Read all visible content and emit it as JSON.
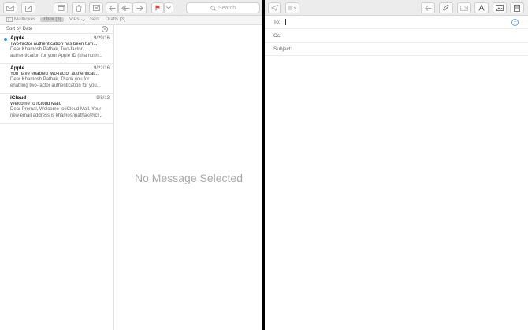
{
  "mail": {
    "search": {
      "placeholder": "Search"
    },
    "favorites": {
      "mailboxes": "Mailboxes",
      "inbox": "Inbox (3)",
      "vips": "VIPs",
      "sent": "Sent",
      "drafts": "Drafts (3)"
    },
    "sort_label": "Sort by Date",
    "messages": [
      {
        "sender": "Apple",
        "date": "9/29/16",
        "subject": "Two-factor authentication has been turn...",
        "preview1": "Dear Khamosh Pathak, Two-factor",
        "preview2": "authentication for your Apple ID (khamosh...",
        "unread": true
      },
      {
        "sender": "Apple",
        "date": "9/22/16",
        "subject": "You have enabled two-factor authenticat...",
        "preview1": "Dear Khamosh Pathak, Thank you for",
        "preview2": "enabling two-factor authentication for you...",
        "unread": false
      },
      {
        "sender": "iCloud",
        "date": "9/8/13",
        "subject": "Welcome to iCloud Mail.",
        "preview1": "Dear Premal, Welcome to iCloud Mail. Your",
        "preview2": "new email address is khamoshpathak@icl...",
        "unread": false
      }
    ],
    "no_message": "No Message Selected"
  },
  "compose": {
    "to_label": "To:",
    "cc_label": "Cc:",
    "subject_label": "Subject:"
  },
  "colors": {
    "accent": "#3b8fdf",
    "flag": "#e0403a"
  }
}
